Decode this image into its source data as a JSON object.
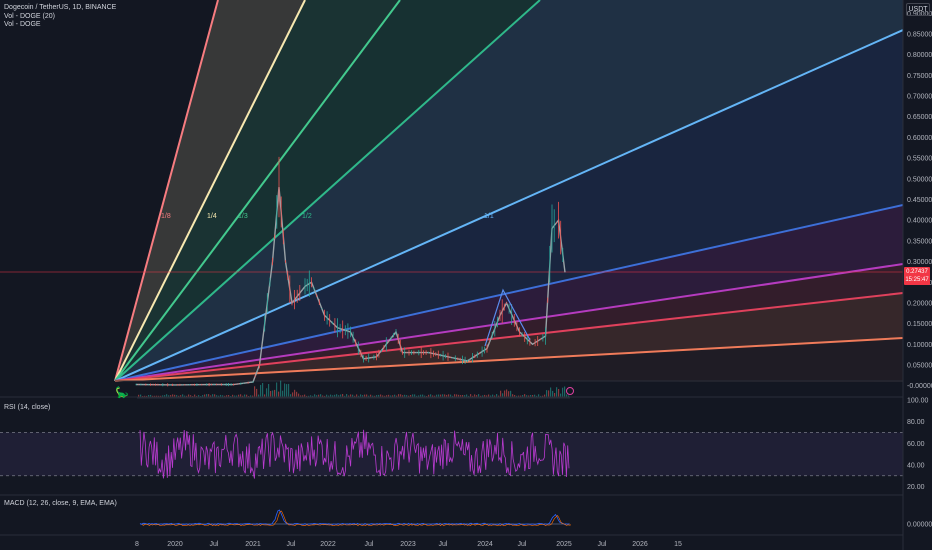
{
  "header": {
    "title": "Dogecoin / TetherUS, 1D, BINANCE",
    "line2": "Vol - DOGE (20)",
    "line3": "Vol - DOGE",
    "currency": "USDT"
  },
  "price_axis": {
    "ticks": [
      "0.90000",
      "0.85000",
      "0.80000",
      "0.75000",
      "0.70000",
      "0.65000",
      "0.60000",
      "0.55000",
      "0.50000",
      "0.45000",
      "0.40000",
      "0.35000",
      "0.30000",
      "0.25000",
      "0.20000",
      "0.15000",
      "0.10000",
      "0.05000",
      "-0.00000"
    ],
    "last_price": "0.27437",
    "last_time": "15:25:47",
    "last_color": "#f23645"
  },
  "rsi": {
    "label": "RSI (14, close)",
    "ticks": [
      "100.00",
      "80.00",
      "60.00",
      "40.00",
      "20.00"
    ]
  },
  "macd": {
    "label": "MACD (12, 26, close, 9, EMA, EMA)",
    "ticks": [
      "0.00000"
    ]
  },
  "time_axis": {
    "labels": [
      "8",
      "2020",
      "Jul",
      "2021",
      "Jul",
      "2022",
      "Jul",
      "2023",
      "Jul",
      "2024",
      "Jul",
      "2025",
      "Jul",
      "2026",
      "15"
    ]
  },
  "fan": {
    "labels": [
      "1/8",
      "1/4",
      "1/3",
      "1/2",
      "1/1"
    ],
    "colors": [
      "#f77c80",
      "#f7e8b0",
      "#43c98e",
      "#2fb88a",
      "#64b5f6",
      "#3d6fd8",
      "#b53bbf",
      "#e0415c",
      "#f07b5a"
    ]
  },
  "chart_data": {
    "type": "line",
    "title": "Dogecoin / TetherUS, 1D, BINANCE",
    "ylim": [
      -0.02,
      0.92
    ],
    "series": [
      {
        "name": "DOGEUSDT",
        "x": [
          "2019-07",
          "2019-10",
          "2020-01",
          "2020-04",
          "2020-07",
          "2020-10",
          "2021-01",
          "2021-02",
          "2021-04",
          "2021-05",
          "2021-06",
          "2021-07",
          "2021-09",
          "2021-10",
          "2021-12",
          "2022-02",
          "2022-04",
          "2022-06",
          "2022-08",
          "2022-11",
          "2022-12",
          "2023-01",
          "2023-04",
          "2023-07",
          "2023-10",
          "2024-01",
          "2024-03",
          "2024-04",
          "2024-06",
          "2024-08",
          "2024-10",
          "2024-11",
          "2024-12",
          "2025-01"
        ],
        "values": [
          0.003,
          0.0025,
          0.002,
          0.0025,
          0.003,
          0.0028,
          0.009,
          0.05,
          0.3,
          0.48,
          0.3,
          0.2,
          0.24,
          0.25,
          0.17,
          0.14,
          0.13,
          0.065,
          0.07,
          0.13,
          0.08,
          0.08,
          0.08,
          0.07,
          0.06,
          0.09,
          0.17,
          0.2,
          0.13,
          0.1,
          0.12,
          0.38,
          0.4,
          0.274
        ]
      }
    ]
  }
}
